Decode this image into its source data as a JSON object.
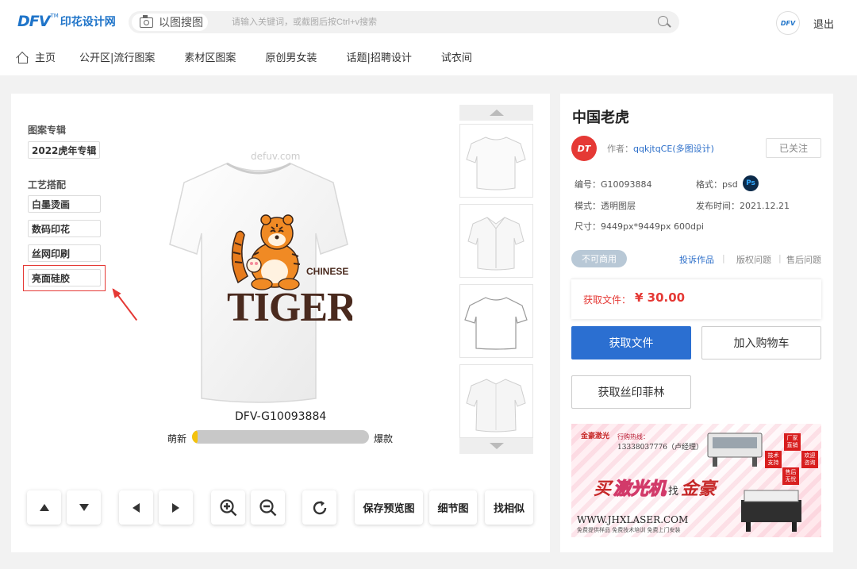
{
  "header": {
    "logo_text": "DFV",
    "logo_tm": "TM",
    "logo_cn": "印花设计网",
    "image_search_label": "以图搜图",
    "search_placeholder": "请输入关键词，或截图后按Ctrl+v搜索",
    "user_avatar_text": "DFV",
    "logout_label": "退出"
  },
  "nav": {
    "home": "主页",
    "items": [
      "公开区|流行图案",
      "素材区图案",
      "原创男女装",
      "话题|招聘设计",
      "试衣间"
    ]
  },
  "sidebar": {
    "group1_title": "图案专辑",
    "group1_tags": [
      "2022虎年专辑"
    ],
    "group2_title": "工艺搭配",
    "group2_tags": [
      "白墨烫画",
      "数码印花",
      "丝网印刷",
      "亮面硅胶"
    ]
  },
  "preview": {
    "watermark": "defuv.com",
    "print_main": "TIGER",
    "print_sub": "CHINESE",
    "code": "DFV-G10093884",
    "popularity_left": "萌新",
    "popularity_right": "爆款",
    "popularity_level": 0.02,
    "popularity_color": "#f4c20d"
  },
  "thumbnails": [
    "tshirt-front",
    "shirt-collar",
    "tshirt-outline",
    "shirt-loose"
  ],
  "controls": {
    "save_preview": "保存预览图",
    "detail": "细节图",
    "find_similar": "找相似"
  },
  "info": {
    "title": "中国老虎",
    "author_logo": "DT",
    "author_prefix": "作者：",
    "author_name": "qqkjtqCE(多图设计)",
    "follow_label": "已关注",
    "id_text": "编号：G10093884",
    "format_text": "格式：psd",
    "format_icon": "Ps",
    "mode_text": "模式：透明图层",
    "date_text": "发布时间：2021.12.21",
    "size_text": "尺寸：9449px*9449px 600dpi",
    "commercial_badge": "不可商用",
    "report_link": "投诉作品",
    "copyright_link": "版权问题",
    "aftersale_link": "售后问题",
    "price_label": "获取文件：",
    "price_value": "¥ 30.00",
    "get_file_button": "获取文件",
    "add_cart_button": "加入购物车",
    "get_film_button": "获取丝印菲林",
    "accent_color": "#2b6fd1",
    "price_color": "#e53935"
  },
  "ad": {
    "logo": "金豪激光",
    "hotline_label": "行购热线：",
    "phone": "13338037776（卢经理）",
    "slogan_1": "买",
    "slogan_2": "激光机",
    "slogan_3": "找",
    "slogan_4": "金豪",
    "url": "WWW.JHXLASER.COM",
    "sub": "免费提供样品 免费技术培训 免费上门安装",
    "badges": [
      "厂家直销",
      "技术支持",
      "欢迎咨询",
      "售后无忧"
    ]
  }
}
